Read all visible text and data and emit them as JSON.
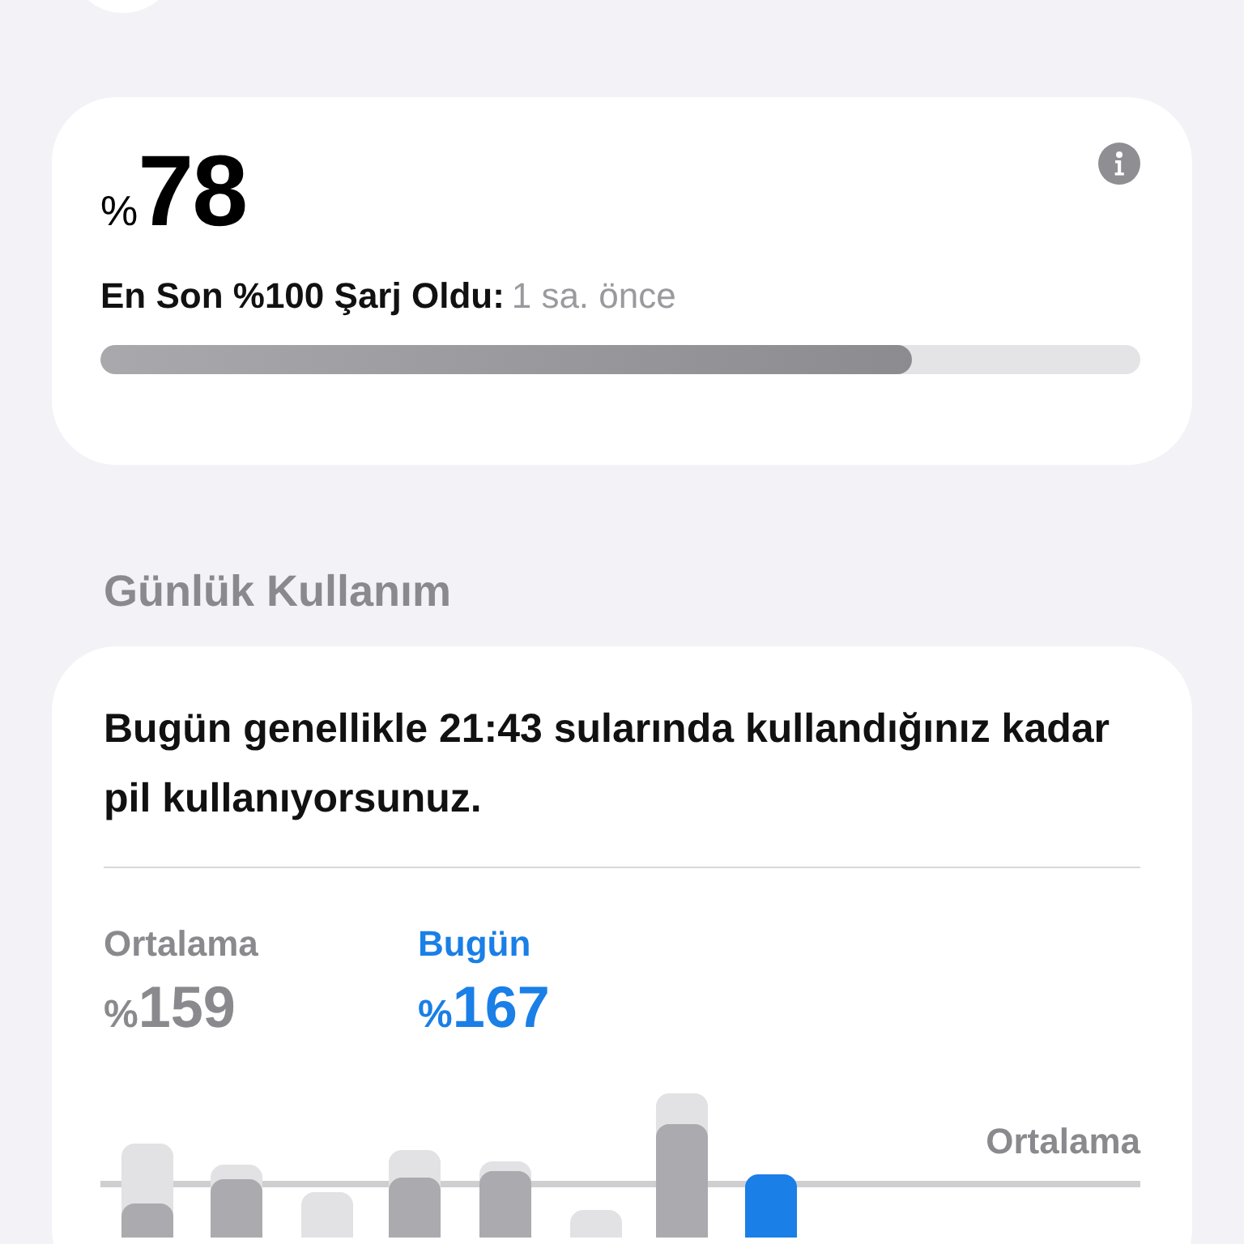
{
  "battery": {
    "symbol": "%",
    "value": "78",
    "last_charge_label": "En Son %100 Şarj Oldu:",
    "last_charge_time": "1 sa. önce",
    "level": 0.78
  },
  "daily_usage": {
    "heading": "Günlük Kullanım",
    "summary": "Bugün genellikle 21:43 sularında kullandığınız kadar pil kullanıyorsunuz.",
    "stats": [
      {
        "kind": "average",
        "label": "Ortalama",
        "symbol": "%",
        "value": "159"
      },
      {
        "kind": "today",
        "label": "Bugün",
        "symbol": "%",
        "value": "167"
      }
    ],
    "chart_average_label": "Ortalama"
  }
}
